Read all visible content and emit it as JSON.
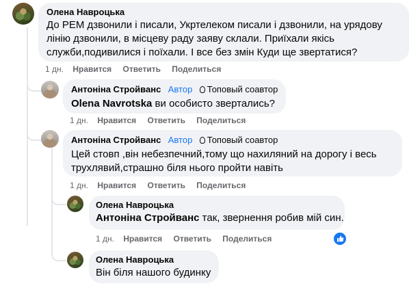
{
  "comments": [
    {
      "author": "Олена Навроцька",
      "text": "До РЕМ дзвонили і писали, Укртелеком писали і дзвонили, на урядову лінію дзвонили, в місцеву раду заяву склали. Приїхали якісь служби,подивилися і поїхали. І все без змін Куди ще звертатися?",
      "time": "1 дн.",
      "like": "Нравится",
      "reply": "Ответить",
      "share": "Поделиться"
    },
    {
      "author": "Антоніна Стройванс",
      "author_badge": "Автор",
      "contributor_badge": "Топовый соавтор",
      "mention": "Olena Navrotska",
      "text": " ви особисто звертались?",
      "time": "1 дн.",
      "like": "Нравится",
      "reply": "Ответить",
      "share": "Поделиться"
    },
    {
      "author": "Антоніна Стройванс",
      "author_badge": "Автор",
      "contributor_badge": "Топовый соавтор",
      "text": "Цей стовп ,він небезпечний,тому що нахиляний на дорогу і весь трухлявий,страшно біля нього пройти навіть",
      "time": "1 дн.",
      "like": "Нравится",
      "reply": "Ответить",
      "share": "Поделиться"
    },
    {
      "author": "Олена Навроцька",
      "mention": "Антоніна Стройванс",
      "text": " так, звернення робив мій син.",
      "time": "1 дн.",
      "like": "Нравится",
      "reply": "Ответить",
      "share": "Поделиться"
    },
    {
      "author": "Олена Навроцька",
      "text": "Він біля нашого будинку"
    }
  ],
  "colors": {
    "bubble": "#f0f2f5",
    "meta": "#65676b",
    "accent": "#1877f2"
  },
  "icons": {
    "contributor": "badge-icon",
    "reaction": "like-reaction-icon"
  }
}
